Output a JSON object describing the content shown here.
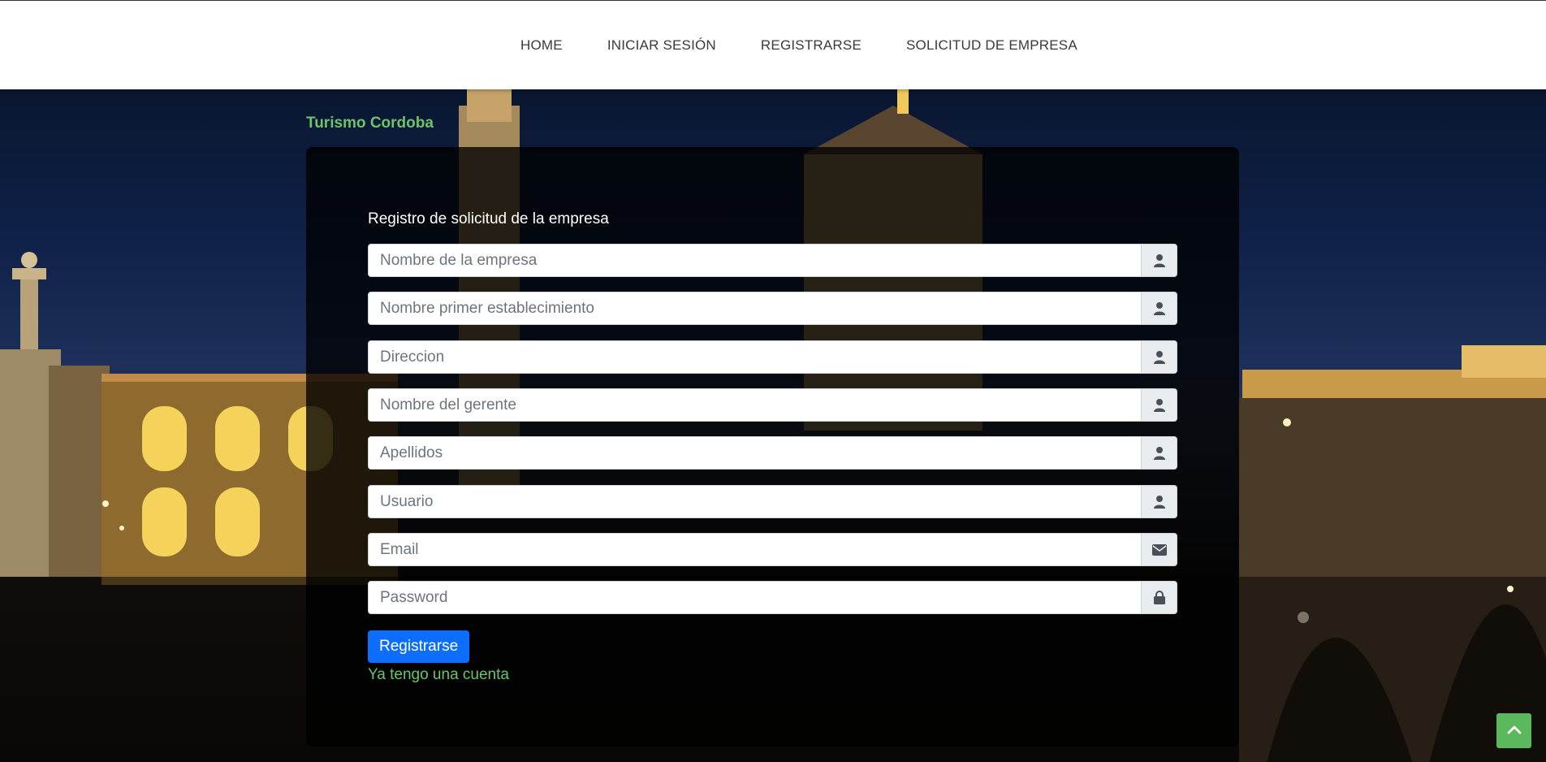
{
  "nav": {
    "items": [
      {
        "label": "HOME"
      },
      {
        "label": "INICIAR SESIÓN"
      },
      {
        "label": "REGISTRARSE"
      },
      {
        "label": "SOLICITUD DE EMPRESA"
      }
    ]
  },
  "brand": "Turismo Cordoba",
  "form": {
    "title": "Registro de solicitud de la empresa",
    "fields": [
      {
        "placeholder": "Nombre de la empresa",
        "value": "",
        "icon": "user-icon"
      },
      {
        "placeholder": "Nombre primer establecimiento",
        "value": "",
        "icon": "user-icon"
      },
      {
        "placeholder": "Direccion",
        "value": "",
        "icon": "user-icon"
      },
      {
        "placeholder": "Nombre del gerente",
        "value": "",
        "icon": "user-icon"
      },
      {
        "placeholder": "Apellidos",
        "value": "",
        "icon": "user-icon"
      },
      {
        "placeholder": "Usuario",
        "value": "",
        "icon": "user-icon"
      },
      {
        "placeholder": "Email",
        "value": "",
        "icon": "envelope-icon"
      },
      {
        "placeholder": "Password",
        "value": "",
        "icon": "lock-icon"
      }
    ],
    "submit_label": "Registrarse",
    "login_link": "Ya tengo una cuenta"
  },
  "colors": {
    "accent_green": "#6ac46a",
    "primary_button": "#0d6efd",
    "back_to_top": "#5cb85c"
  },
  "back_to_top_icon": "chevron-up-icon"
}
